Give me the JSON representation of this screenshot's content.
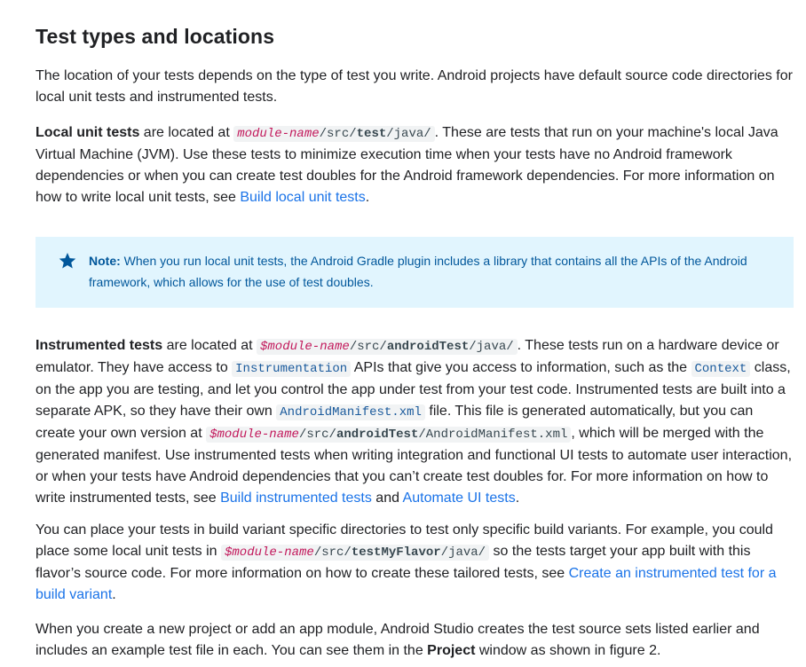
{
  "heading": "Test types and locations",
  "intro": "The location of your tests depends on the type of test you write. Android projects have default source code directories for local unit tests and instrumented tests.",
  "local": {
    "lead": "Local unit tests",
    "t1": " are located at ",
    "code_var": "module-name",
    "code_path_a": "/src/",
    "code_path_b": "test",
    "code_path_c": "/java/",
    "t2": ". These are tests that run on your machine's local Java Virtual Machine (JVM). Use these tests to minimize execution time when your tests have no Android framework dependencies or when you can create test doubles for the Android framework dependencies. For more information on how to write local unit tests, see ",
    "link": "Build local unit tests",
    "t3": "."
  },
  "note": {
    "icon": "star-icon",
    "label": "Note:",
    "text": " When you run local unit tests, the Android Gradle plugin includes a library that contains all the APIs of the Android framework, which allows for the use of test doubles."
  },
  "instrumented": {
    "lead": "Instrumented tests",
    "t1": " are located at ",
    "code1_var": "$module-name",
    "code1_a": "/src/",
    "code1_b": "androidTest",
    "code1_c": "/java/",
    "t2": ". These tests run on a hardware device or emulator. They have access to ",
    "code2": "Instrumentation",
    "t3": " APIs that give you access to information, such as the ",
    "code3": "Context",
    "t4": " class, on the app you are testing, and let you control the app under test from your test code. Instrumented tests are built into a separate APK, so they have their own ",
    "code4": "AndroidManifest.xml",
    "t5": " file. This file is generated automatically, but you can create your own version at ",
    "code5_var": "$module-name",
    "code5_a": "/src/",
    "code5_b": "androidTest",
    "code5_c": "/AndroidManifest.xml",
    "t6": ", which will be merged with the generated manifest. Use instrumented tests when writing integration and functional UI tests to automate user interaction, or when your tests have Android dependencies that you can’t create test doubles for. For more information on how to write instrumented tests, see ",
    "link1": "Build instrumented tests",
    "t7": " and ",
    "link2": "Automate UI tests",
    "t8": "."
  },
  "variants": {
    "t1": "You can place your tests in build variant specific directories to test only specific build variants. For example, you could place some local unit tests in ",
    "code_var": "$module-name",
    "code_a": "/src/",
    "code_b": "testMyFlavor",
    "code_c": "/java/",
    "t2": " so the tests target your app built with this flavor’s source code. For more information on how to create these tailored tests, see ",
    "link": "Create an instrumented test for a build variant",
    "t3": "."
  },
  "closing": {
    "t1": "When you create a new project or add an app module, Android Studio creates the test source sets listed earlier and includes an example test file in each. You can see them in the ",
    "bold": "Project",
    "t2": " window as shown in figure 2."
  },
  "colors": {
    "text": "#202124",
    "link": "#1a73e8",
    "note_bg": "#e1f5fe",
    "note_text": "#01579b",
    "code_var": "#c2185b"
  }
}
